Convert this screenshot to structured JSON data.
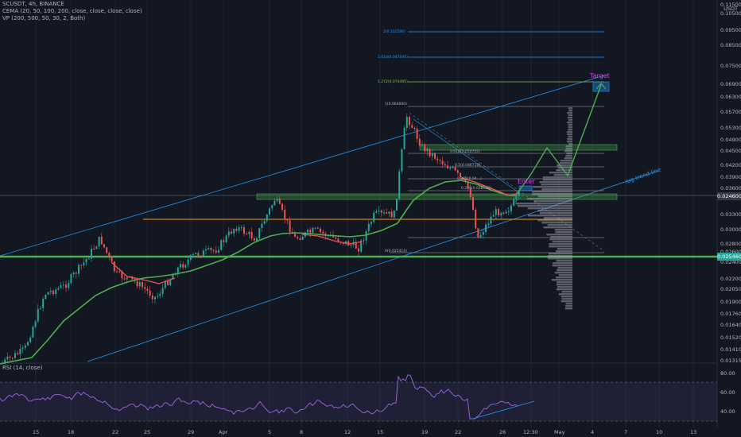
{
  "header": {
    "symbol_line": "SCUSDT, 4h, BINANCE",
    "cema_line": "CEMA (20, 50, 100, 200, close, close, close, close)",
    "vp_line": "VP (200, 500, 50, 30, 2, Both)",
    "rsi_line": "RSI (14, close)",
    "currency": "USDT"
  },
  "price_axis": {
    "ticks": [
      "0.115000",
      "0.105000",
      "0.095000",
      "0.085000",
      "0.075000",
      "0.069000",
      "0.063000",
      "0.057000",
      "0.053000",
      "0.049000",
      "0.045000",
      "0.042000",
      "0.039000",
      "0.036000",
      "0.033000",
      "0.030000",
      "0.028000",
      "0.026000",
      "0.024000",
      "0.022000",
      "0.020500",
      "0.019000",
      "0.017600",
      "0.016400",
      "0.015200",
      "0.014100",
      "0.013150"
    ],
    "current_price": "0.025460",
    "current_price2": "0.024600"
  },
  "rsi_axis": {
    "ticks": [
      "80.00",
      "60.00",
      "40.00"
    ]
  },
  "time_axis": {
    "ticks": [
      "15",
      "18",
      "22",
      "25",
      "29",
      "Apr",
      "5",
      "8",
      "12",
      "15",
      "19",
      "22",
      "26",
      "12:30",
      "May",
      "4",
      "7",
      "10",
      "13"
    ]
  },
  "fib_labels": [
    "2(0.102586)",
    "1.618(0.087846)",
    "1.272(0.074495)",
    "1(0.064000)",
    "0.618(0.050755)",
    "0.5(0.046710)",
    "0.382(0.04...)",
    "0.236(0.038136)",
    "0(0.025414)"
  ],
  "annotations": {
    "target": "Target",
    "enter": "Enter",
    "trend": "log trend line"
  },
  "colors": {
    "bg": "#131722",
    "up": "#26a69a",
    "down": "#ef5350",
    "ema": "#4caf50",
    "rsi": "#7e57c2",
    "fib": "#2196f3",
    "support": "#4caf50"
  }
}
